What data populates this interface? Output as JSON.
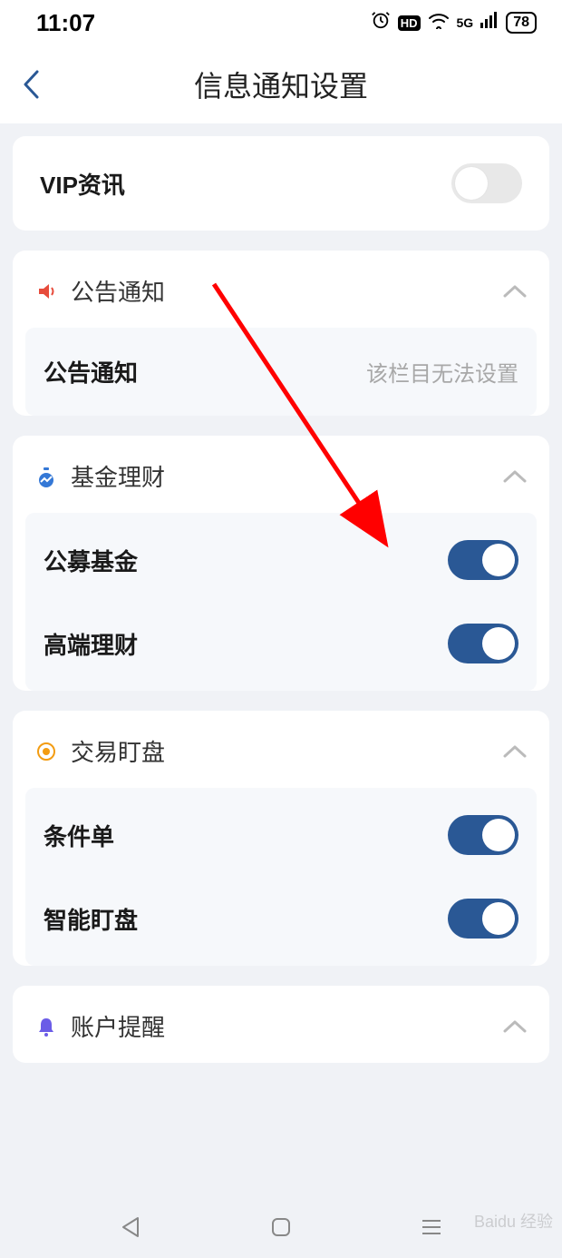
{
  "status": {
    "time": "11:07",
    "battery": "78",
    "network": "5G"
  },
  "header": {
    "title": "信息通知设置"
  },
  "card_vip": {
    "label": "VIP资讯",
    "toggle_on": false
  },
  "section_notice": {
    "title": "公告通知",
    "row": {
      "label": "公告通知",
      "note": "该栏目无法设置"
    }
  },
  "section_fund": {
    "title": "基金理财",
    "row1": {
      "label": "公募基金",
      "toggle_on": true
    },
    "row2": {
      "label": "高端理财",
      "toggle_on": true
    }
  },
  "section_trade": {
    "title": "交易盯盘",
    "row1": {
      "label": "条件单",
      "toggle_on": true
    },
    "row2": {
      "label": "智能盯盘",
      "toggle_on": true
    }
  },
  "section_account": {
    "title": "账户提醒"
  },
  "watermark": "Baidu 经验"
}
